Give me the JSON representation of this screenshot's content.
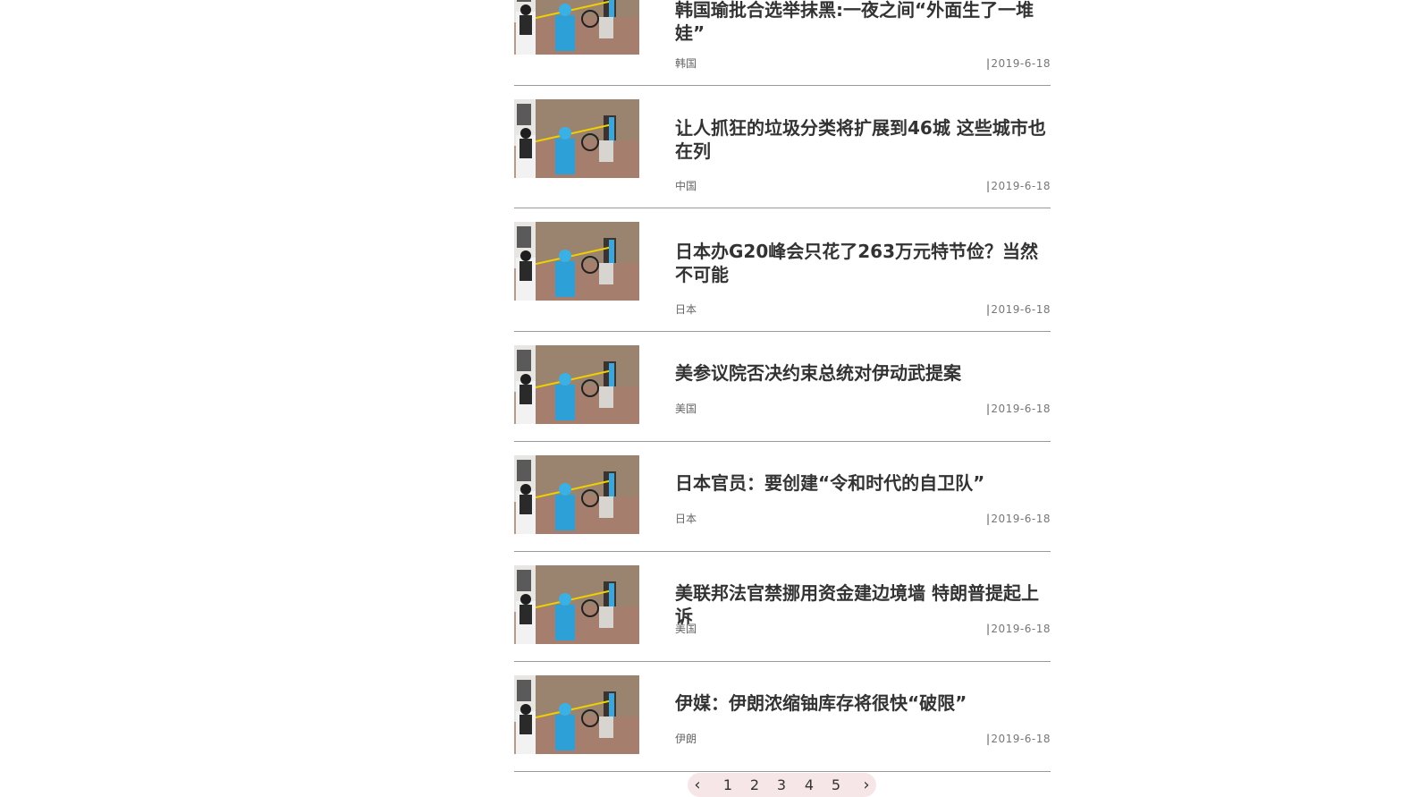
{
  "articles": [
    {
      "title": "韩国瑜批合选举抹黑:一夜之间“外面生了一堆娃”",
      "tag": "韩国",
      "separator": "|",
      "date": "2019-6-18"
    },
    {
      "title": "让人抓狂的垃圾分类将扩展到46城 这些城市也在列",
      "tag": "中国",
      "separator": "|",
      "date": "2019-6-18"
    },
    {
      "title": "日本办G20峰会只花了263万元特节俭？当然不可能",
      "tag": "日本",
      "separator": "|",
      "date": "2019-6-18"
    },
    {
      "title": "美参议院否决约束总统对伊动武提案",
      "tag": "美国",
      "separator": "|",
      "date": "2019-6-18"
    },
    {
      "title": "日本官员：要创建“令和时代的自卫队”",
      "tag": "日本",
      "separator": "|",
      "date": "2019-6-18"
    },
    {
      "title": "美联邦法官禁挪用资金建边境墙 特朗普提起上诉",
      "tag": "美国",
      "separator": "|",
      "date": "2019-6-18"
    },
    {
      "title": "伊媒：伊朗浓缩铀库存将很快“破限”",
      "tag": "伊朗",
      "separator": "|",
      "date": "2019-6-18"
    }
  ],
  "pagination": {
    "prev": "‹",
    "pages": [
      "1",
      "2",
      "3",
      "4",
      "5"
    ],
    "next": "›"
  },
  "colors": {
    "divider": "#999999",
    "pagination_bg": "#f6e6e8"
  }
}
